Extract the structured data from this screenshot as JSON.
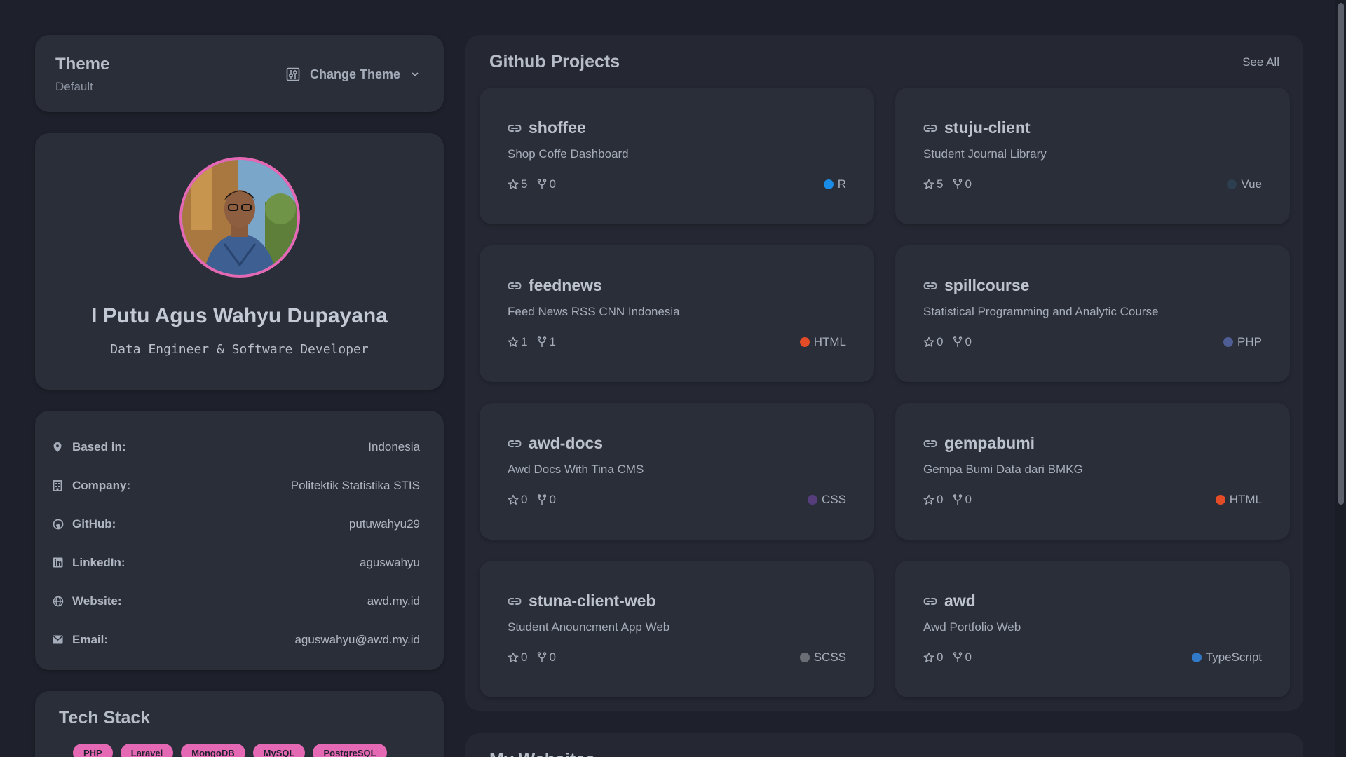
{
  "theme": {
    "title": "Theme",
    "current": "Default",
    "change_label": "Change Theme"
  },
  "profile": {
    "name": "I Putu Agus Wahyu Dupayana",
    "role": "Data Engineer & Software Developer"
  },
  "info": [
    {
      "icon": "location-pin-icon",
      "label": "Based in:",
      "value": "Indonesia"
    },
    {
      "icon": "building-icon",
      "label": "Company:",
      "value": "Politektik Statistika STIS"
    },
    {
      "icon": "github-icon",
      "label": "GitHub:",
      "value": "putuwahyu29"
    },
    {
      "icon": "linkedin-icon",
      "label": "LinkedIn:",
      "value": "aguswahyu"
    },
    {
      "icon": "globe-icon",
      "label": "Website:",
      "value": "awd.my.id"
    },
    {
      "icon": "mail-icon",
      "label": "Email:",
      "value": "aguswahyu@awd.my.id"
    }
  ],
  "tech": {
    "title": "Tech Stack",
    "badges": [
      "PHP",
      "Laravel",
      "MongoDB",
      "MySQL",
      "PostgreSQL"
    ]
  },
  "projects": {
    "title": "Github Projects",
    "see_all": "See All",
    "items": [
      {
        "name": "shoffee",
        "desc": "Shop Coffe Dashboard",
        "stars": "5",
        "forks": "0",
        "lang": "R",
        "lang_color": "#198ce7"
      },
      {
        "name": "stuju-client",
        "desc": "Student Journal Library",
        "stars": "5",
        "forks": "0",
        "lang": "Vue",
        "lang_color": "#2c3e50"
      },
      {
        "name": "feednews",
        "desc": "Feed News RSS CNN Indonesia",
        "stars": "1",
        "forks": "1",
        "lang": "HTML",
        "lang_color": "#e34c26"
      },
      {
        "name": "spillcourse",
        "desc": "Statistical Programming and Analytic Course",
        "stars": "0",
        "forks": "0",
        "lang": "PHP",
        "lang_color": "#4f5d95"
      },
      {
        "name": "awd-docs",
        "desc": "Awd Docs With Tina CMS",
        "stars": "0",
        "forks": "0",
        "lang": "CSS",
        "lang_color": "#563d7c"
      },
      {
        "name": "gempabumi",
        "desc": "Gempa Bumi Data dari BMKG",
        "stars": "0",
        "forks": "0",
        "lang": "HTML",
        "lang_color": "#e34c26"
      },
      {
        "name": "stuna-client-web",
        "desc": "Student Anouncment App Web",
        "stars": "0",
        "forks": "0",
        "lang": "SCSS",
        "lang_color": "#6b6e75"
      },
      {
        "name": "awd",
        "desc": "Awd Portfolio Web",
        "stars": "0",
        "forks": "0",
        "lang": "TypeScript",
        "lang_color": "#3178c6"
      }
    ]
  },
  "my_websites": {
    "title": "My Websites"
  }
}
